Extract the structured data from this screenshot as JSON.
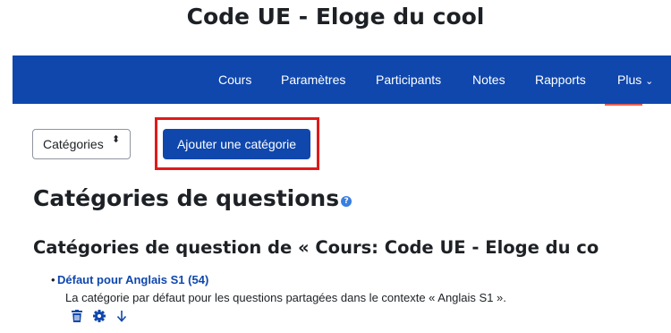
{
  "course": {
    "title": "Code UE - Eloge du cool"
  },
  "navbar": {
    "items": [
      "Cours",
      "Paramètres",
      "Participants",
      "Notes",
      "Rapports",
      "Plus"
    ],
    "more_chevron": "⌄",
    "active_underline_color": "#e8604f",
    "bg_color": "#0f47ad"
  },
  "toolbar": {
    "select_value": "Catégories",
    "select_arrow": "⬍",
    "add_button": "Ajouter une catégorie"
  },
  "page": {
    "heading": "Catégories de questions",
    "subheading": "Catégories de question de « Cours: Code UE - Eloge du co"
  },
  "category": {
    "name": "Défaut pour Anglais S1 (54)",
    "description": "La catégorie par défaut pour les questions partagées dans le contexte « Anglais S1 ».",
    "actions": [
      "trash-icon",
      "gear-icon",
      "arrow-down-icon"
    ]
  }
}
